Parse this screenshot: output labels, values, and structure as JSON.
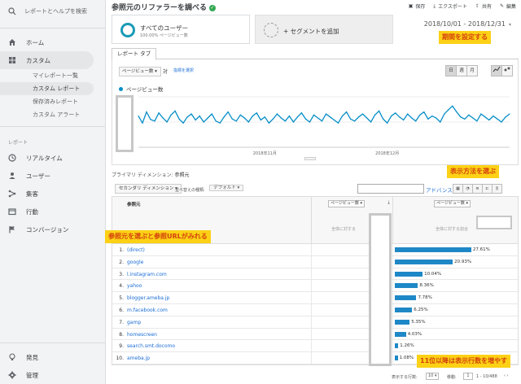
{
  "sidebar": {
    "search_label": "レポートとヘルプを検索",
    "items": [
      {
        "label": "ホーム"
      },
      {
        "label": "カスタム"
      }
    ],
    "sub_items": [
      {
        "label": "マイレポート一覧"
      },
      {
        "label": "カスタム レポート"
      },
      {
        "label": "保存済みレポート"
      },
      {
        "label": "カスタム アラート"
      }
    ],
    "section_label": "レポート",
    "report_items": [
      {
        "label": "リアルタイム"
      },
      {
        "label": "ユーザー"
      },
      {
        "label": "集客"
      },
      {
        "label": "行動"
      },
      {
        "label": "コンバージョン"
      }
    ],
    "bottom_items": [
      {
        "label": "発見"
      },
      {
        "label": "管理"
      }
    ]
  },
  "header": {
    "title": "参照元のリファラーを調べる",
    "toolbar": {
      "save": "保存",
      "export": "エクスポート",
      "share": "共有",
      "edit": "編集"
    }
  },
  "segments": {
    "segment1_name": "すべてのユーザー",
    "segment1_sub": "100.00% ページビュー数",
    "segment2_name": "+ セグメントを追加"
  },
  "date_range": "2018/10/01 - 2018/12/31",
  "notes": {
    "date": "期間を設定する",
    "view": "表示方法を選ぶ",
    "source": "参照元を選ぶと参照URLがみれる",
    "rows": "11位以降は表示行数を増やす"
  },
  "tab": {
    "label": "レポート タブ"
  },
  "graph": {
    "metric_select": "ページビュー数 ▾",
    "vs_label": "対",
    "metric_link": "指標を選択",
    "period_buttons": [
      "日",
      "週",
      "月"
    ],
    "legend": "ページビュー数",
    "x_ticks": [
      "2018年11月",
      "2018年12月"
    ]
  },
  "chart_data": {
    "type": "line",
    "series": [
      {
        "name": "ページビュー数",
        "values": [
          62,
          48,
          70,
          55,
          52,
          68,
          58,
          50,
          64,
          72,
          56,
          48,
          60,
          66,
          54,
          62,
          50,
          58,
          66,
          52,
          48,
          60,
          70,
          56,
          52,
          64,
          58,
          50,
          62,
          68,
          54,
          60,
          48,
          56,
          66,
          58,
          52,
          62,
          50,
          60,
          68,
          56,
          50,
          64,
          58,
          52,
          66,
          60,
          54,
          48,
          62,
          70,
          56,
          52,
          60,
          66,
          58,
          50,
          64,
          72,
          56,
          48,
          62,
          68,
          60,
          54,
          66,
          58,
          52,
          64,
          70,
          56,
          62,
          58,
          50,
          66,
          74,
          82,
          70,
          60,
          56,
          64,
          58,
          52,
          66,
          60,
          54,
          62,
          56,
          50,
          60,
          66
        ]
      }
    ],
    "x_ticks": [
      "2018年11月",
      "2018年12月"
    ]
  },
  "dimension": {
    "label": "プライマリ ディメンション:",
    "value": "参照元"
  },
  "controls": {
    "secondary": "セカンダリ ディメンション ▾",
    "sort_label": "並べ替えの種類:",
    "sort_value": "デフォルト ▾",
    "advanced": "アドバンス"
  },
  "table": {
    "dim_header": "参照元",
    "col1_select": "ページビュー数 ▾",
    "col2_select": "ページビュー数 ▾",
    "col1_total": "全体に対する",
    "col2_total": "全体に対する割合",
    "rows": [
      {
        "num": "1.",
        "name": "(direct)",
        "pct": "27.61%",
        "ratio": 0.2761
      },
      {
        "num": "2.",
        "name": "google",
        "pct": "20.93%",
        "ratio": 0.2093
      },
      {
        "num": "3.",
        "name": "l.instagram.com",
        "pct": "10.04%",
        "ratio": 0.1004
      },
      {
        "num": "4.",
        "name": "yahoo",
        "pct": "8.36%",
        "ratio": 0.0836
      },
      {
        "num": "5.",
        "name": "blogger.ameba.jp",
        "pct": "7.78%",
        "ratio": 0.0778
      },
      {
        "num": "6.",
        "name": "m.facebook.com",
        "pct": "6.25%",
        "ratio": 0.0625
      },
      {
        "num": "7.",
        "name": "gamp",
        "pct": "5.35%",
        "ratio": 0.0535
      },
      {
        "num": "8.",
        "name": "homescreen",
        "pct": "4.03%",
        "ratio": 0.0403
      },
      {
        "num": "9.",
        "name": "search.smt.docomo",
        "pct": "1.26%",
        "ratio": 0.0126
      },
      {
        "num": "10.",
        "name": "ameba.jp",
        "pct": "1.08%",
        "ratio": 0.0108
      }
    ]
  },
  "footer": {
    "rows_label": "表示する行数:",
    "rows_value": "10 ▾",
    "goto_label": "移動:",
    "goto_value": "1",
    "range": "1 - 10/488"
  }
}
